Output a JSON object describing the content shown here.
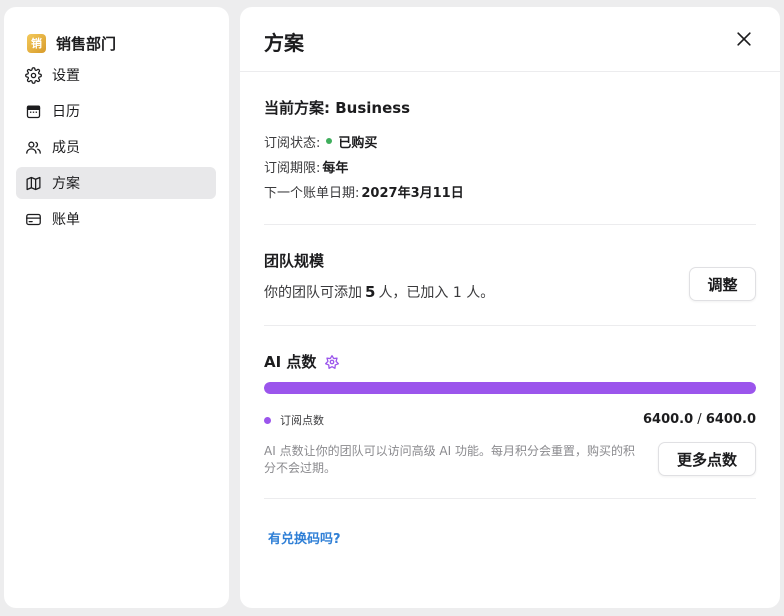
{
  "sidebar": {
    "org": {
      "logo_char": "销",
      "name": "销售部门"
    },
    "items": [
      {
        "label": "设置",
        "icon": "gear-icon"
      },
      {
        "label": "日历",
        "icon": "calendar-icon"
      },
      {
        "label": "成员",
        "icon": "users-icon"
      },
      {
        "label": "方案",
        "icon": "map-icon",
        "active": true
      },
      {
        "label": "账单",
        "icon": "credit-card-icon"
      }
    ]
  },
  "main": {
    "title": "方案",
    "plan": {
      "current": "当前方案: Business",
      "status_label": "订阅状态:",
      "status_value": "已购买",
      "period_label": "订阅期限:",
      "period_value": "每年",
      "next_bill_label": "下一个账单日期:",
      "next_bill_value": "2027年3月11日"
    },
    "team": {
      "title": "团队规模",
      "desc_prefix": "你的团队可添加",
      "limit": "5",
      "desc_suffix": "人，已加入 1 人。",
      "adjust_label": "调整"
    },
    "ai": {
      "title": "AI 点数",
      "progress_fraction": 1.0,
      "legend_label": "订阅点数",
      "used": "6400.0",
      "separator": " / ",
      "total": "6400.0",
      "desc": "AI 点数让你的团队可以访问高级 AI 功能。每月积分会重置，购买的积分不会过期。",
      "more_label": "更多点数"
    },
    "redeem_label": "有兑换码吗?"
  },
  "colors": {
    "accent_purple": "#9b55ec",
    "status_green": "#3fae5c",
    "link_blue": "#2f7fd6"
  }
}
